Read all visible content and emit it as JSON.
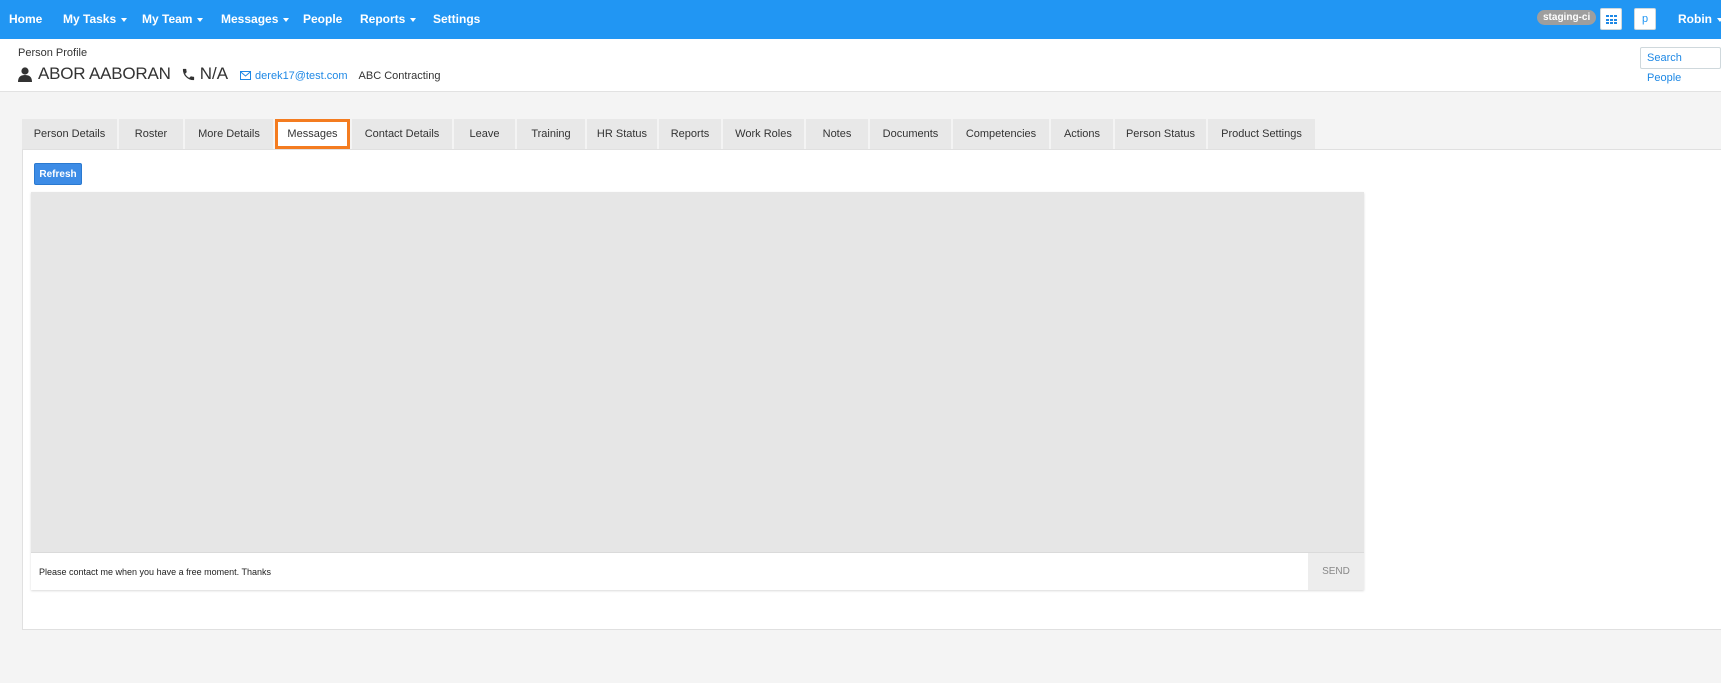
{
  "nav": {
    "items": [
      {
        "label": "Home",
        "caret": false
      },
      {
        "label": "My Tasks",
        "caret": true
      },
      {
        "label": "My Team",
        "caret": true
      },
      {
        "label": "Messages",
        "caret": true
      },
      {
        "label": "People",
        "caret": false
      },
      {
        "label": "Reports",
        "caret": true
      },
      {
        "label": "Settings",
        "caret": false
      }
    ],
    "env_badge": "staging-ci",
    "apps_icon": "grid-icon",
    "p_button": "p",
    "user_menu": "Robin"
  },
  "profile": {
    "section_label": "Person Profile",
    "name": "ABOR AABORAN",
    "phone": "N/A",
    "email": "derek17@test.com",
    "company": "ABC Contracting",
    "search_button": "Search People"
  },
  "tabs": [
    {
      "label": "Person Details",
      "active": false
    },
    {
      "label": "Roster",
      "active": false
    },
    {
      "label": "More Details",
      "active": false
    },
    {
      "label": "Messages",
      "active": true
    },
    {
      "label": "Contact Details",
      "active": false
    },
    {
      "label": "Leave",
      "active": false
    },
    {
      "label": "Training",
      "active": false
    },
    {
      "label": "HR Status",
      "active": false
    },
    {
      "label": "Reports",
      "active": false
    },
    {
      "label": "Work Roles",
      "active": false
    },
    {
      "label": "Notes",
      "active": false
    },
    {
      "label": "Documents",
      "active": false
    },
    {
      "label": "Competencies",
      "active": false
    },
    {
      "label": "Actions",
      "active": false
    },
    {
      "label": "Person Status",
      "active": false
    },
    {
      "label": "Product Settings",
      "active": false
    }
  ],
  "messages": {
    "refresh_label": "Refresh",
    "compose_value": "Please contact me when you have a free moment. Thanks",
    "send_label": "SEND"
  },
  "colors": {
    "primary": "#2196f3",
    "active_tab_border": "#f47c20",
    "refresh_button": "#3d8ce6"
  }
}
